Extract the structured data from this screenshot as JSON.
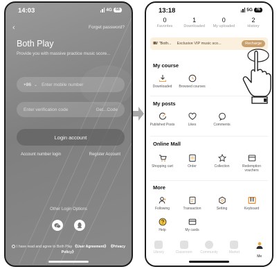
{
  "left": {
    "status": {
      "time": "14:03",
      "network": "4G",
      "battery": "68"
    },
    "forgot_password": "Forget password?",
    "title": "Both Play",
    "subtitle": "Provide you with massive practice music score...",
    "phone_field": {
      "country_code": "+86",
      "placeholder": "Enter mobile number"
    },
    "code_field": {
      "placeholder": "Enter verification code",
      "get_code": "Get...Code"
    },
    "login_button": "Login account",
    "links": {
      "number_login": "Account number login",
      "register": "Register Account"
    },
    "other_login": "Other Login Options",
    "agreement": {
      "prefix": "I have read and agree to Both Play ",
      "user_agreement": "《User Agreement》",
      "privacy": "《Privacy Policy》"
    }
  },
  "right": {
    "status": {
      "time": "13:18",
      "network": "5G",
      "battery": "76"
    },
    "stats": [
      {
        "count": "0",
        "label": "Favorites"
      },
      {
        "count": "1",
        "label": "Downloaded"
      },
      {
        "count": "0",
        "label": "My uploaded"
      },
      {
        "count": "2",
        "label": "History"
      }
    ],
    "vip_banner": {
      "logo": "Ⅲ/",
      "name": "\"Both...",
      "message": "Exclusive VIP music sco...",
      "button": "Recharge"
    },
    "my_course": {
      "title": "My course",
      "items": [
        "Downloaded",
        "Browsed courses"
      ]
    },
    "my_posts": {
      "title": "My posts",
      "items": [
        "Published Posts",
        "Likes",
        "Comments"
      ]
    },
    "online_mall": {
      "title": "Online Mall",
      "items": [
        "Shopping cart",
        "Order",
        "Collection",
        "Redemption vouchers"
      ]
    },
    "more": {
      "title": "More",
      "row1": [
        "Following",
        "Transaction",
        "Setting",
        "Keyboard"
      ],
      "row2": [
        "Help",
        "My cards"
      ]
    },
    "tabbar": [
      "Library",
      "Classroom",
      "Community",
      "Market",
      "Me"
    ]
  },
  "colors": {
    "accent": "#c9a06d",
    "vip_bg": "#fbf0dd",
    "keyboard_icon": "#e98a2c",
    "help_icon": "#f3c33b"
  }
}
